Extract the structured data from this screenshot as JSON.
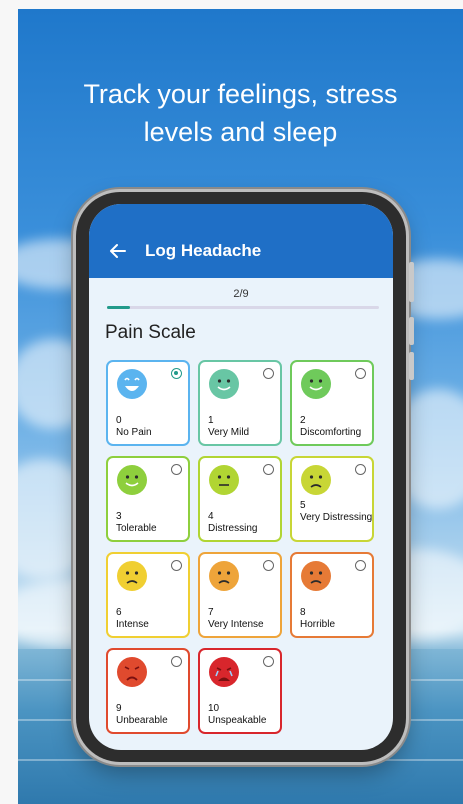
{
  "headline": {
    "line1": "Track your feelings, stress",
    "line2": "levels and sleep"
  },
  "app": {
    "title": "Log Headache",
    "back_icon": "arrow-left-icon"
  },
  "progress": {
    "label": "2/9",
    "fraction": 0.0833,
    "color": "#229a8a"
  },
  "section_title": "Pain Scale",
  "options": [
    {
      "value": "0",
      "label": "No Pain",
      "selected": true,
      "color": "#5bb4ef",
      "face": "laughing"
    },
    {
      "value": "1",
      "label": "Very Mild",
      "selected": false,
      "color": "#68c6a4",
      "face": "smile"
    },
    {
      "value": "2",
      "label": "Discomforting",
      "selected": false,
      "color": "#6fca5b",
      "face": "smile"
    },
    {
      "value": "3",
      "label": "Tolerable",
      "selected": false,
      "color": "#8ecf3d",
      "face": "smile"
    },
    {
      "value": "4",
      "label": "Distressing",
      "selected": false,
      "color": "#b1d533",
      "face": "neutral"
    },
    {
      "value": "5",
      "label": "Very Distressing",
      "selected": false,
      "color": "#c8d636",
      "face": "frown"
    },
    {
      "value": "6",
      "label": "Intense",
      "selected": false,
      "color": "#f0cf32",
      "face": "frown"
    },
    {
      "value": "7",
      "label": "Very Intense",
      "selected": false,
      "color": "#eea43a",
      "face": "frown"
    },
    {
      "value": "8",
      "label": "Horrible",
      "selected": false,
      "color": "#e67a36",
      "face": "frown"
    },
    {
      "value": "9",
      "label": "Unbearable",
      "selected": false,
      "color": "#e04a2e",
      "face": "angry"
    },
    {
      "value": "10",
      "label": "Unspeakable",
      "selected": false,
      "color": "#d8262c",
      "face": "crying"
    }
  ],
  "colors": {
    "appbar": "#1f6fc6",
    "screen_bg": "#eaf3fb"
  }
}
